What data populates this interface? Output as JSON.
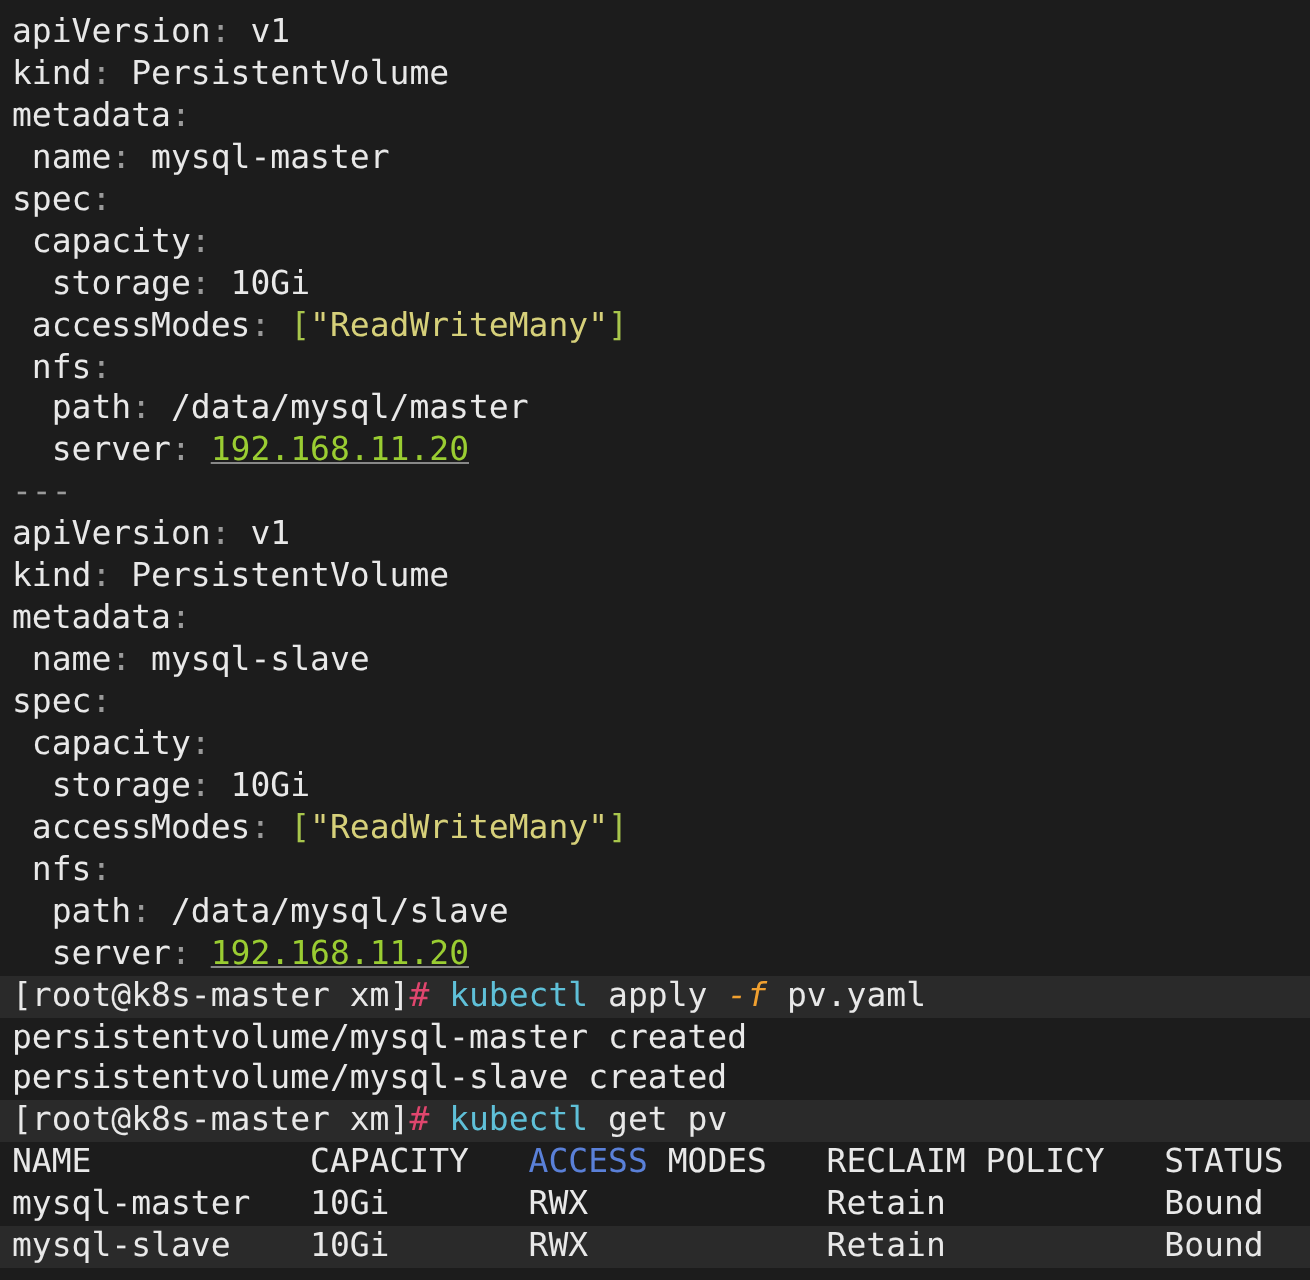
{
  "terminal": {
    "lines": [
      {
        "highlighted": false,
        "segments": [
          {
            "kind": "key",
            "text": "apiVersion"
          },
          {
            "kind": "punct",
            "text": ": "
          },
          {
            "kind": "plain",
            "text": "v1"
          }
        ]
      },
      {
        "highlighted": false,
        "segments": [
          {
            "kind": "key",
            "text": "kind"
          },
          {
            "kind": "punct",
            "text": ": "
          },
          {
            "kind": "plain",
            "text": "PersistentVolume"
          }
        ]
      },
      {
        "highlighted": false,
        "segments": [
          {
            "kind": "key",
            "text": "metadata"
          },
          {
            "kind": "punct",
            "text": ":"
          }
        ]
      },
      {
        "highlighted": false,
        "segments": [
          {
            "kind": "key",
            "text": " name"
          },
          {
            "kind": "punct",
            "text": ": "
          },
          {
            "kind": "plain",
            "text": "mysql-master"
          }
        ]
      },
      {
        "highlighted": false,
        "segments": [
          {
            "kind": "key",
            "text": "spec"
          },
          {
            "kind": "punct",
            "text": ":"
          }
        ]
      },
      {
        "highlighted": false,
        "segments": [
          {
            "kind": "key",
            "text": " capacity"
          },
          {
            "kind": "punct",
            "text": ":"
          }
        ]
      },
      {
        "highlighted": false,
        "segments": [
          {
            "kind": "key",
            "text": "  storage"
          },
          {
            "kind": "punct",
            "text": ": "
          },
          {
            "kind": "plain",
            "text": "10Gi"
          }
        ]
      },
      {
        "highlighted": false,
        "segments": [
          {
            "kind": "key",
            "text": " accessModes"
          },
          {
            "kind": "punct",
            "text": ": "
          },
          {
            "kind": "bracket",
            "text": "["
          },
          {
            "kind": "string",
            "text": "\"ReadWriteMany\""
          },
          {
            "kind": "bracket",
            "text": "]"
          }
        ]
      },
      {
        "highlighted": false,
        "segments": [
          {
            "kind": "key",
            "text": " nfs"
          },
          {
            "kind": "punct",
            "text": ":"
          }
        ]
      },
      {
        "highlighted": false,
        "segments": [
          {
            "kind": "key",
            "text": "  path"
          },
          {
            "kind": "punct",
            "text": ": "
          },
          {
            "kind": "plain",
            "text": "/data/mysql/master"
          }
        ]
      },
      {
        "highlighted": false,
        "segments": [
          {
            "kind": "key",
            "text": "  server"
          },
          {
            "kind": "punct",
            "text": ": "
          },
          {
            "kind": "ip",
            "text": "192.168.11.20"
          }
        ]
      },
      {
        "highlighted": false,
        "segments": [
          {
            "kind": "punct",
            "text": "---"
          }
        ]
      },
      {
        "highlighted": false,
        "segments": [
          {
            "kind": "key",
            "text": "apiVersion"
          },
          {
            "kind": "punct",
            "text": ": "
          },
          {
            "kind": "plain",
            "text": "v1"
          }
        ]
      },
      {
        "highlighted": false,
        "segments": [
          {
            "kind": "key",
            "text": "kind"
          },
          {
            "kind": "punct",
            "text": ": "
          },
          {
            "kind": "plain",
            "text": "PersistentVolume"
          }
        ]
      },
      {
        "highlighted": false,
        "segments": [
          {
            "kind": "key",
            "text": "metadata"
          },
          {
            "kind": "punct",
            "text": ":"
          }
        ]
      },
      {
        "highlighted": false,
        "segments": [
          {
            "kind": "key",
            "text": " name"
          },
          {
            "kind": "punct",
            "text": ": "
          },
          {
            "kind": "plain",
            "text": "mysql-slave"
          }
        ]
      },
      {
        "highlighted": false,
        "segments": [
          {
            "kind": "key",
            "text": "spec"
          },
          {
            "kind": "punct",
            "text": ":"
          }
        ]
      },
      {
        "highlighted": false,
        "segments": [
          {
            "kind": "key",
            "text": " capacity"
          },
          {
            "kind": "punct",
            "text": ":"
          }
        ]
      },
      {
        "highlighted": false,
        "segments": [
          {
            "kind": "key",
            "text": "  storage"
          },
          {
            "kind": "punct",
            "text": ": "
          },
          {
            "kind": "plain",
            "text": "10Gi"
          }
        ]
      },
      {
        "highlighted": false,
        "segments": [
          {
            "kind": "key",
            "text": " accessModes"
          },
          {
            "kind": "punct",
            "text": ": "
          },
          {
            "kind": "bracket",
            "text": "["
          },
          {
            "kind": "string",
            "text": "\"ReadWriteMany\""
          },
          {
            "kind": "bracket",
            "text": "]"
          }
        ]
      },
      {
        "highlighted": false,
        "segments": [
          {
            "kind": "key",
            "text": " nfs"
          },
          {
            "kind": "punct",
            "text": ":"
          }
        ]
      },
      {
        "highlighted": false,
        "segments": [
          {
            "kind": "key",
            "text": "  path"
          },
          {
            "kind": "punct",
            "text": ": "
          },
          {
            "kind": "plain",
            "text": "/data/mysql/slave"
          }
        ]
      },
      {
        "highlighted": false,
        "segments": [
          {
            "kind": "key",
            "text": "  server"
          },
          {
            "kind": "punct",
            "text": ": "
          },
          {
            "kind": "ip",
            "text": "192.168.11.20"
          }
        ]
      },
      {
        "highlighted": true,
        "segments": [
          {
            "kind": "plain",
            "text": "[root@k8s-master xm]"
          },
          {
            "kind": "hash",
            "text": "# "
          },
          {
            "kind": "command",
            "text": "kubectl"
          },
          {
            "kind": "plain",
            "text": " apply "
          },
          {
            "kind": "flag",
            "text": "-f"
          },
          {
            "kind": "plain",
            "text": " pv.yaml"
          }
        ]
      },
      {
        "highlighted": false,
        "segments": [
          {
            "kind": "plain",
            "text": "persistentvolume/mysql-master created"
          }
        ]
      },
      {
        "highlighted": false,
        "segments": [
          {
            "kind": "plain",
            "text": "persistentvolume/mysql-slave created"
          }
        ]
      },
      {
        "highlighted": true,
        "segments": [
          {
            "kind": "plain",
            "text": "[root@k8s-master xm]"
          },
          {
            "kind": "hash",
            "text": "# "
          },
          {
            "kind": "command",
            "text": "kubectl"
          },
          {
            "kind": "plain",
            "text": " get pv"
          }
        ]
      },
      {
        "highlighted": false,
        "segments": [
          {
            "kind": "plain",
            "text": "NAME           CAPACITY   "
          },
          {
            "kind": "accent",
            "text": "ACCESS"
          },
          {
            "kind": "plain",
            "text": " MODES   RECLAIM POLICY   STATUS"
          }
        ]
      },
      {
        "highlighted": false,
        "segments": [
          {
            "kind": "plain",
            "text": "mysql-master   10Gi       RWX            Retain           Bound"
          }
        ]
      },
      {
        "highlighted": true,
        "segments": [
          {
            "kind": "plain",
            "text": "mysql-slave    10Gi       RWX            Retain           Bound"
          }
        ]
      }
    ]
  }
}
